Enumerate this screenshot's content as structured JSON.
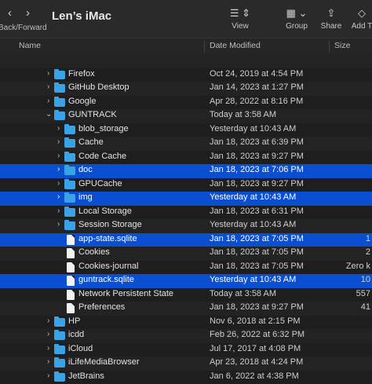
{
  "window": {
    "title": "Len’s iMac"
  },
  "toolbar": {
    "back_forward_caption": "Back/Forward",
    "back_glyph": "‹",
    "forward_glyph": "›",
    "view": {
      "icon": "list-view-icon",
      "label": "View"
    },
    "group": {
      "icon": "group-grid-icon",
      "label": "Group"
    },
    "share": {
      "icon": "share-icon",
      "label": "Share"
    },
    "add_tags": {
      "icon": "tag-icon",
      "label": "Add T"
    }
  },
  "columns": {
    "name": "Name",
    "date": "Date Modified",
    "size": "Size"
  },
  "colors": {
    "selection": "#0a4fd1",
    "folder": "#3aa3e8",
    "background": "#1e1e1e"
  },
  "rows": [
    {
      "name": "",
      "date": "",
      "size": ""
    },
    {
      "name": "Firefox",
      "date": "Oct 24, 2019 at 4:54 PM",
      "size": ""
    },
    {
      "name": "GitHub Desktop",
      "date": "Jan 14, 2023 at 1:27 PM",
      "size": ""
    },
    {
      "name": "Google",
      "date": "Apr 28, 2022 at 8:16 PM",
      "size": ""
    },
    {
      "name": "GUNTRACK",
      "date": "Today at 3:58 AM",
      "size": ""
    },
    {
      "name": "blob_storage",
      "date": "Yesterday at 10:43 AM",
      "size": ""
    },
    {
      "name": "Cache",
      "date": "Jan 18, 2023 at 6:39 PM",
      "size": ""
    },
    {
      "name": "Code Cache",
      "date": "Jan 18, 2023 at 9:27 PM",
      "size": ""
    },
    {
      "name": "doc",
      "date": "Jan 18, 2023 at 7:06 PM",
      "size": ""
    },
    {
      "name": "GPUCache",
      "date": "Jan 18, 2023 at 9:27 PM",
      "size": ""
    },
    {
      "name": "img",
      "date": "Yesterday at 10:43 AM",
      "size": ""
    },
    {
      "name": "Local Storage",
      "date": "Jan 18, 2023 at 6:31 PM",
      "size": ""
    },
    {
      "name": "Session Storage",
      "date": "Yesterday at 10:43 AM",
      "size": ""
    },
    {
      "name": "app-state.sqlite",
      "date": "Jan 18, 2023 at 7:05 PM",
      "size": "1"
    },
    {
      "name": "Cookies",
      "date": "Jan 18, 2023 at 7:05 PM",
      "size": "2"
    },
    {
      "name": "Cookies-journal",
      "date": "Jan 18, 2023 at 7:05 PM",
      "size": "Zero k"
    },
    {
      "name": "guntrack.sqlite",
      "date": "Yesterday at 10:43 AM",
      "size": "10"
    },
    {
      "name": "Network Persistent State",
      "date": "Today at 3:58 AM",
      "size": "557"
    },
    {
      "name": "Preferences",
      "date": "Jan 18, 2023 at 9:27 PM",
      "size": "41"
    },
    {
      "name": "HP",
      "date": "Nov 6, 2018 at 2:15 PM",
      "size": ""
    },
    {
      "name": "icdd",
      "date": "Feb 26, 2022 at 6:32 PM",
      "size": ""
    },
    {
      "name": "iCloud",
      "date": "Jul 17, 2017 at 4:08 PM",
      "size": ""
    },
    {
      "name": "iLifeMediaBrowser",
      "date": "Apr 23, 2018 at 4:24 PM",
      "size": ""
    },
    {
      "name": "JetBrains",
      "date": "Jan 6, 2022 at 4:38 PM",
      "size": ""
    }
  ]
}
